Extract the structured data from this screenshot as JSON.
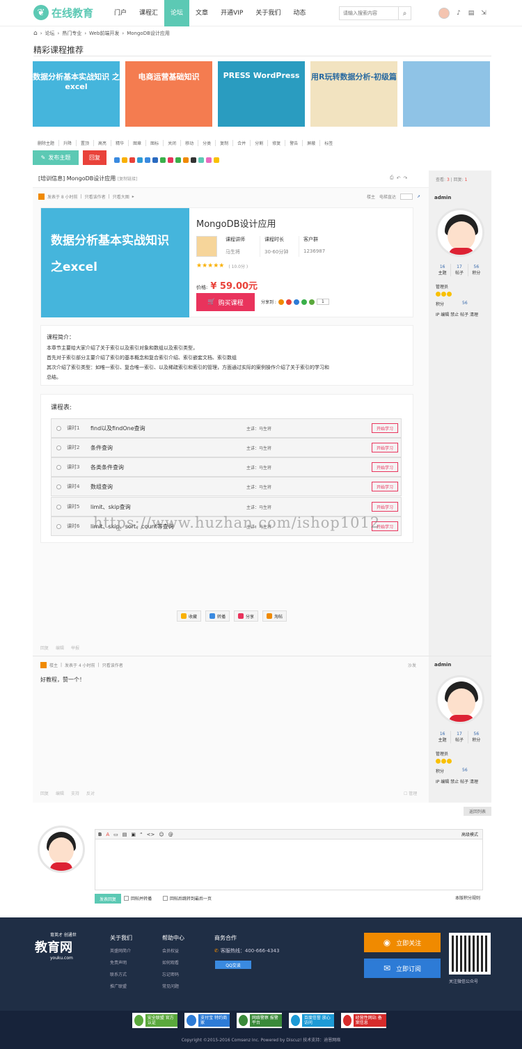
{
  "nav": {
    "logo_text": "在线教育",
    "items": [
      "门户",
      "课程汇",
      "论坛",
      "文章",
      "开通VIP",
      "关于我们",
      "动态"
    ],
    "active": 2,
    "search_placeholder": "请输入搜索内容"
  },
  "breadcrumb": [
    "论坛",
    "热门专业",
    "Web前端开发",
    "MongoDB设计应用"
  ],
  "section_title": "精彩课程推荐",
  "banners": [
    {
      "text": "数据分析基本实战知识 之excel",
      "color": "#45b5dc"
    },
    {
      "text": "电商运营基础知识",
      "color": "#f47c50"
    },
    {
      "text": "PRESS WordPress",
      "color": "#2a9cc0"
    },
    {
      "text": "用R玩转数据分析-初级篇",
      "color": "#f2e3c0"
    },
    {
      "text": "",
      "color": "#8fc3e6"
    }
  ],
  "toolbar": [
    "删除主题",
    "升降",
    "置顶",
    "高亮",
    "精华",
    "图章",
    "图标",
    "关闭",
    "移动",
    "分类",
    "复制",
    "合并",
    "分割",
    "修复",
    "警告",
    "屏蔽",
    "标签"
  ],
  "post_button": "发布主题",
  "reply_button": "回复",
  "views_label": "查看:",
  "views": "3",
  "replies_label": "回复:",
  "replies": "1",
  "thread": {
    "title": "[培训信息] MongoDB设计应用",
    "copy_link": "[复制链接]",
    "meta": [
      "发表于 8 小时前",
      "只看该作者",
      "只看大图"
    ],
    "right_meta": [
      "楼主",
      "电梯直达"
    ]
  },
  "course": {
    "image_text_1": "数据分析基本实战知识",
    "image_text_2": "之excel",
    "title": "MongoDB设计应用",
    "info": [
      {
        "label": "课程讲师",
        "value": "马生将"
      },
      {
        "label": "课程时长",
        "value": "30-60分钟"
      },
      {
        "label": "客户群",
        "value": "1236987"
      }
    ],
    "rating_text": "( 10.0分 )",
    "price_label": "价格:",
    "price": "¥ 59.00元",
    "buy_label": "购买课程",
    "share_label": "分享到 :",
    "share_count": "1"
  },
  "intro": {
    "heading": "课程简介：",
    "lines": [
      "本章节主要给大家介绍了关于索引以及索引对象和数组以及索引类型，",
      "首先对于索引部分主要介绍了索引的基本概念和复合索引介绍、索引嵌套文档、索引数组",
      "其次介绍了索引类型：如唯一索引、复合唯一索引、以及稀疏索引和索引的管理，方面通过实际的案例操作介绍了关于索引的学习和",
      "总结。"
    ]
  },
  "lessons": {
    "heading": "课程表:",
    "start_label": "开始学习",
    "items": [
      {
        "num": "课时1",
        "name": "find以及findOne查询",
        "lecturer": "主讲：马生将"
      },
      {
        "num": "课时2",
        "name": "条件查询",
        "lecturer": "主讲：马生将"
      },
      {
        "num": "课时3",
        "name": "各类条件查询",
        "lecturer": "主讲：马生将"
      },
      {
        "num": "课时4",
        "name": "数组查询",
        "lecturer": "主讲：马生将"
      },
      {
        "num": "课时5",
        "name": "limit、skip查询",
        "lecturer": "主讲：马生将"
      },
      {
        "num": "课时6",
        "name": "limit、skip、sort、count等查询",
        "lecturer": "主讲：马生将"
      }
    ]
  },
  "watermark": "https://www.huzhan.com/ishop1012",
  "post_actions": [
    "收藏",
    "转播",
    "分享",
    "淘帖"
  ],
  "post_footer": [
    "回复",
    "编辑",
    "举报"
  ],
  "reply": {
    "meta": [
      "楼主",
      "发表于 4 小时前",
      "只看该作者"
    ],
    "sofa": "沙发",
    "text": "好教程，赞一个！",
    "footer": [
      "回复",
      "编辑",
      "支持",
      "反对"
    ],
    "manage": "管理"
  },
  "user": {
    "name": "admin",
    "stats": [
      {
        "value": "16",
        "label": "主题"
      },
      {
        "value": "17",
        "label": "帖子"
      },
      {
        "value": "56",
        "label": "积分"
      }
    ],
    "role": "管理员",
    "points_label": "积分",
    "points": "56",
    "ops": "IP 编辑 禁止 帖子 清理"
  },
  "back_list": "返回列表",
  "editor": {
    "tools": [
      "B",
      "A",
      "▭",
      "▤",
      "▣",
      "“",
      "<>",
      "☺",
      "@"
    ],
    "advanced": "高级模式",
    "submit": "发表回复",
    "check1": "回帖并转播",
    "check2": "回帖后跳转到最后一页",
    "rules": "本版积分规则"
  },
  "footer": {
    "logo_top": "育英才 创通世",
    "logo_main": "教育网",
    "logo_sub": "youku.com",
    "about_title": "关于我们",
    "about_items": [
      "英盛网简介",
      "免责声明",
      "联系方式",
      "推广联盟"
    ],
    "help_title": "帮助中心",
    "help_items": [
      "会员权益",
      "如何观看",
      "忘记密码",
      "常见问题"
    ],
    "biz_title": "商务合作",
    "hotline": "客服热线：400-666-4343",
    "qq": "QQ交谈",
    "follow": "立即关注",
    "subscribe": "立即订阅",
    "qr_caption": "关注微信公众号",
    "badges": [
      {
        "text": "安全联盟 官方认证",
        "color": "#5aa83c"
      },
      {
        "text": "支付宝 特约商家",
        "color": "#2d7bd6"
      },
      {
        "text": "网络警察 报警平台",
        "color": "#3a8a3a"
      },
      {
        "text": "百度信誉 放心访问",
        "color": "#1d9ad6"
      },
      {
        "text": "经营性网站 备案信息",
        "color": "#d62b2b"
      }
    ],
    "copyright": "Copyright ©2015-2016  Comsenz Inc.  Powered by Discuz!  技术支持：迪恩网络"
  }
}
